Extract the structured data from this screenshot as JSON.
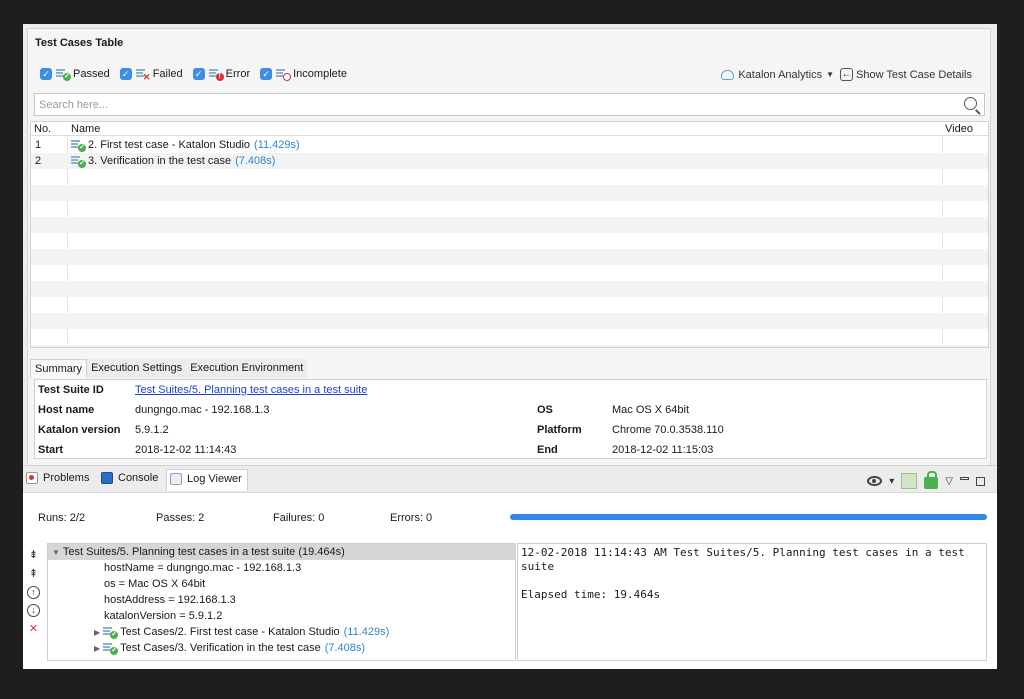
{
  "top_panel": {
    "title": "Test Cases Table",
    "filters": [
      {
        "label": "Passed",
        "checked": true,
        "status": "passed"
      },
      {
        "label": "Failed",
        "checked": true,
        "status": "failed"
      },
      {
        "label": "Error",
        "checked": true,
        "status": "error"
      },
      {
        "label": "Incomplete",
        "checked": true,
        "status": "incomplete"
      }
    ],
    "analytics_label": "Katalon Analytics",
    "show_details_label": "Show Test Case Details",
    "search_placeholder": "Search here...",
    "columns": [
      "No.",
      "Name",
      "Video"
    ],
    "rows": [
      {
        "no": "1",
        "name": "2. First test case - Katalon Studio",
        "duration": "(11.429s)",
        "status": "passed"
      },
      {
        "no": "2",
        "name": "3. Verification in the test case",
        "duration": "(7.408s)",
        "status": "passed"
      }
    ]
  },
  "summary_tabs": [
    "Summary",
    "Execution Settings",
    "Execution Environment"
  ],
  "summary": {
    "suite_id_label": "Test Suite ID",
    "suite_id_value": "Test Suites/5. Planning test cases in a test suite",
    "host_label": "Host name",
    "host_value": "dungngo.mac - 192.168.1.3",
    "version_label": "Katalon version",
    "version_value": "5.9.1.2",
    "start_label": "Start",
    "start_value": "2018-12-02 11:14:43",
    "os_label": "OS",
    "os_value": "Mac OS X 64bit",
    "platform_label": "Platform",
    "platform_value": "Chrome 70.0.3538.110",
    "end_label": "End",
    "end_value": "2018-12-02 11:15:03"
  },
  "bottom_tabs": {
    "problems": "Problems",
    "console": "Console",
    "log_viewer": "Log Viewer"
  },
  "stats": {
    "runs": "Runs:  2/2",
    "passes": "Passes:  2",
    "failures": "Failures:  0",
    "errors": "Errors:  0",
    "progress": 1.0
  },
  "tree": {
    "root": "Test Suites/5. Planning test cases in a test suite (19.464s)",
    "props": [
      "hostName = dungngo.mac - 192.168.1.3",
      "os = Mac OS X 64bit",
      "hostAddress = 192.168.1.3",
      "katalonVersion = 5.9.1.2"
    ],
    "cases": [
      {
        "name": "Test Cases/2. First test case - Katalon Studio",
        "duration": "(11.429s)"
      },
      {
        "name": "Test Cases/3. Verification in the test case",
        "duration": "(7.408s)"
      }
    ]
  },
  "log": "12-02-2018 11:14:43 AM Test Suites/5. Planning test cases in a test suite\n\nElapsed time: 19.464s",
  "colors": {
    "accent": "#2f8ae3",
    "duration": "#2f87c9",
    "pass": "#4caf50",
    "fail": "#d9333a"
  }
}
